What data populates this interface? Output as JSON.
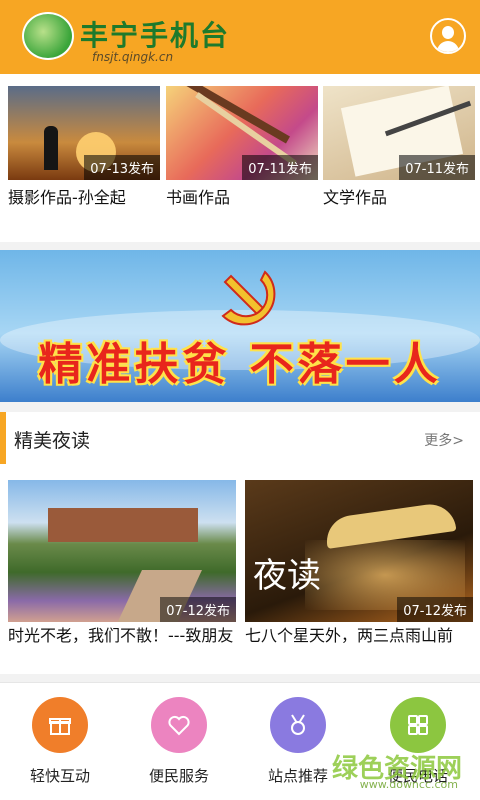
{
  "header": {
    "app_title": "丰宁手机台",
    "subtitle": "fnsjt.qingk.cn"
  },
  "works": [
    {
      "title": "摄影作品-孙全起",
      "date": "07-13发布"
    },
    {
      "title": "书画作品",
      "date": "07-11发布"
    },
    {
      "title": "文学作品",
      "date": "07-11发布"
    }
  ],
  "banner": {
    "text": "精准扶贫 不落一人"
  },
  "reading": {
    "section_title": "精美夜读",
    "more_label": "更多>",
    "items": [
      {
        "title": "时光不老，我们不散！---致朋友",
        "date": "07-12发布"
      },
      {
        "title": "七八个星天外，两三点雨山前",
        "date": "07-12发布",
        "overlay": "夜读"
      }
    ]
  },
  "bottom_nav": [
    {
      "label": "轻快互动",
      "icon": "gift-icon",
      "color": "#f07e2a"
    },
    {
      "label": "便民服务",
      "icon": "heart-icon",
      "color": "#ec84c0"
    },
    {
      "label": "站点推荐",
      "icon": "medal-icon",
      "color": "#8a7ae0"
    },
    {
      "label": "便民电话",
      "icon": "grid-icon",
      "color": "#8cc640"
    }
  ],
  "watermark": {
    "text": "绿色资源网",
    "url": "www.downcc.com"
  }
}
